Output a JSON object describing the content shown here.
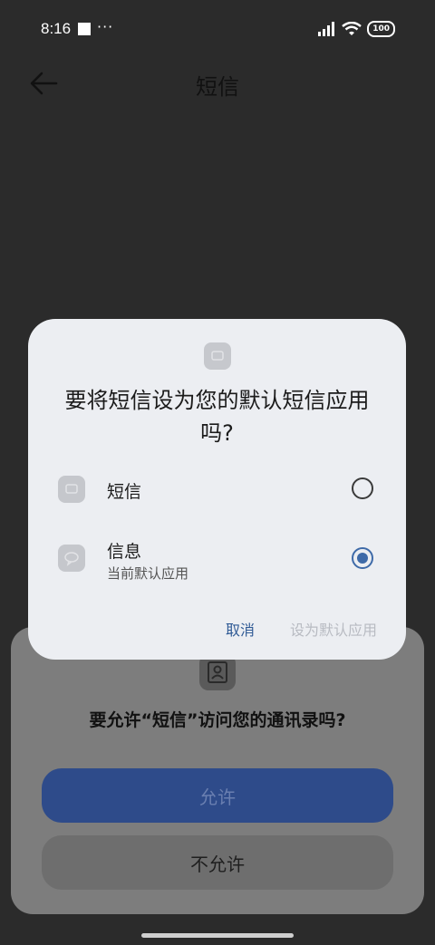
{
  "status_bar": {
    "time": "8:16",
    "dots": "···",
    "battery": "100"
  },
  "app_bar": {
    "title": "短信"
  },
  "dialog": {
    "title": "要将短信设为您的默认短信应用吗?",
    "options": [
      {
        "name": "短信",
        "subtitle": "",
        "selected": false
      },
      {
        "name": "信息",
        "subtitle": "当前默认应用",
        "selected": true
      }
    ],
    "cancel_label": "取消",
    "confirm_label": "设为默认应用"
  },
  "permission_sheet": {
    "title": "要允许“短信”访问您的通讯录吗?",
    "allow_label": "允许",
    "deny_label": "不允许"
  },
  "colors": {
    "accent": "#3e6aa8",
    "allow_button": "#2e4b8a"
  }
}
